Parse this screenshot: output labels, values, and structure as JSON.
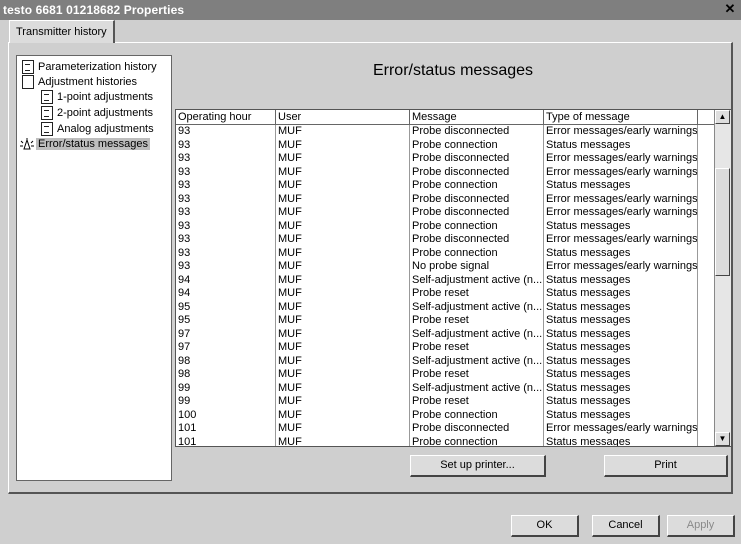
{
  "window": {
    "title": "testo 6681  01218682 Properties",
    "close_glyph": "✕"
  },
  "tabs": [
    {
      "label": "Transmitter history"
    }
  ],
  "tree": {
    "items": [
      {
        "label": "Parameterization history"
      },
      {
        "label": "Adjustment histories"
      },
      {
        "label": "1-point adjustments"
      },
      {
        "label": "2-point adjustments"
      },
      {
        "label": "Analog adjustments"
      },
      {
        "label": "Error/status messages"
      }
    ]
  },
  "main": {
    "heading": "Error/status messages"
  },
  "table": {
    "columns": [
      "Operating hour",
      "User",
      "Message",
      "Type of message"
    ],
    "rows": [
      [
        "93",
        "MUF",
        "Probe disconnected",
        "Error messages/early warnings"
      ],
      [
        "93",
        "MUF",
        "Probe connection",
        "Status messages"
      ],
      [
        "93",
        "MUF",
        "Probe disconnected",
        "Error messages/early warnings"
      ],
      [
        "93",
        "MUF",
        "Probe disconnected",
        "Error messages/early warnings"
      ],
      [
        "93",
        "MUF",
        "Probe connection",
        "Status messages"
      ],
      [
        "93",
        "MUF",
        "Probe disconnected",
        "Error messages/early warnings"
      ],
      [
        "93",
        "MUF",
        "Probe disconnected",
        "Error messages/early warnings"
      ],
      [
        "93",
        "MUF",
        "Probe connection",
        "Status messages"
      ],
      [
        "93",
        "MUF",
        "Probe disconnected",
        "Error messages/early warnings"
      ],
      [
        "93",
        "MUF",
        "Probe connection",
        "Status messages"
      ],
      [
        "93",
        "MUF",
        "No probe signal",
        "Error messages/early warnings"
      ],
      [
        "94",
        "MUF",
        "Self-adjustment active (n...",
        "Status messages"
      ],
      [
        "94",
        "MUF",
        "Probe reset",
        "Status messages"
      ],
      [
        "95",
        "MUF",
        "Self-adjustment active (n...",
        "Status messages"
      ],
      [
        "95",
        "MUF",
        "Probe reset",
        "Status messages"
      ],
      [
        "97",
        "MUF",
        "Self-adjustment active (n...",
        "Status messages"
      ],
      [
        "97",
        "MUF",
        "Probe reset",
        "Status messages"
      ],
      [
        "98",
        "MUF",
        "Self-adjustment active (n...",
        "Status messages"
      ],
      [
        "98",
        "MUF",
        "Probe reset",
        "Status messages"
      ],
      [
        "99",
        "MUF",
        "Self-adjustment active (n...",
        "Status messages"
      ],
      [
        "99",
        "MUF",
        "Probe reset",
        "Status messages"
      ],
      [
        "100",
        "MUF",
        "Probe connection",
        "Status messages"
      ],
      [
        "101",
        "MUF",
        "Probe disconnected",
        "Error messages/early warnings"
      ],
      [
        "101",
        "MUF",
        "Probe connection",
        "Status messages"
      ]
    ]
  },
  "buttons": {
    "setup_printer": "Set up printer...",
    "print": "Print",
    "ok": "OK",
    "cancel": "Cancel",
    "apply": "Apply"
  },
  "icons": {
    "up_arrow": "▲",
    "down_arrow": "▼"
  }
}
